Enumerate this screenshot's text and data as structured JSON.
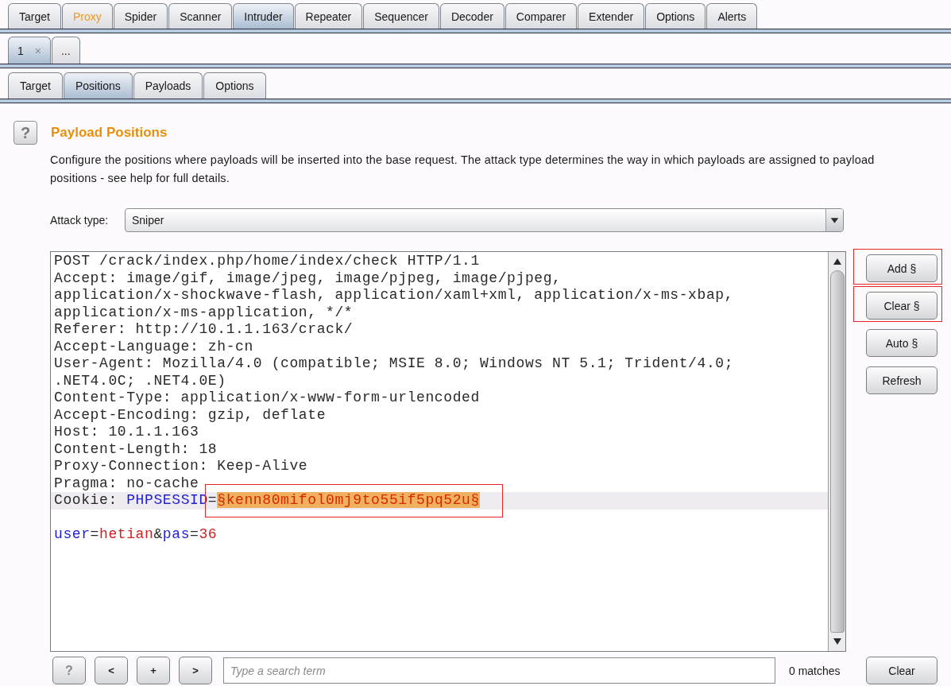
{
  "main_tabs": [
    {
      "label": "Target",
      "selected": false,
      "highlighted": false
    },
    {
      "label": "Proxy",
      "selected": false,
      "highlighted": true
    },
    {
      "label": "Spider",
      "selected": false,
      "highlighted": false
    },
    {
      "label": "Scanner",
      "selected": false,
      "highlighted": false
    },
    {
      "label": "Intruder",
      "selected": true,
      "highlighted": false
    },
    {
      "label": "Repeater",
      "selected": false,
      "highlighted": false
    },
    {
      "label": "Sequencer",
      "selected": false,
      "highlighted": false
    },
    {
      "label": "Decoder",
      "selected": false,
      "highlighted": false
    },
    {
      "label": "Comparer",
      "selected": false,
      "highlighted": false
    },
    {
      "label": "Extender",
      "selected": false,
      "highlighted": false
    },
    {
      "label": "Options",
      "selected": false,
      "highlighted": false
    },
    {
      "label": "Alerts",
      "selected": false,
      "highlighted": false
    }
  ],
  "attack_tabs": [
    {
      "label": "1",
      "close": "×",
      "selected": true
    },
    {
      "label": "...",
      "selected": false
    }
  ],
  "sub_tabs": [
    {
      "label": "Target",
      "selected": false
    },
    {
      "label": "Positions",
      "selected": true
    },
    {
      "label": "Payloads",
      "selected": false
    },
    {
      "label": "Options",
      "selected": false
    }
  ],
  "section": {
    "help": "?",
    "title": "Payload Positions",
    "description": "Configure the positions where payloads will be inserted into the base request. The attack type determines the way in which payloads are assigned to payload positions - see help for full details.",
    "attack_type_label": "Attack type:",
    "attack_type": "Sniper"
  },
  "request": {
    "lines": [
      {
        "kind": "text",
        "current": false,
        "segments": [
          {
            "kind": "plain",
            "text": "POST /crack/index.php/home/index/check HTTP/1.1"
          }
        ]
      },
      {
        "kind": "text",
        "current": false,
        "segments": [
          {
            "kind": "plain",
            "text": "Accept: image/gif, image/jpeg, image/pjpeg, image/pjpeg,"
          }
        ]
      },
      {
        "kind": "text",
        "current": false,
        "segments": [
          {
            "kind": "plain",
            "text": "application/x-shockwave-flash, application/xaml+xml, application/x-ms-xbap,"
          }
        ]
      },
      {
        "kind": "text",
        "current": false,
        "segments": [
          {
            "kind": "plain",
            "text": "application/x-ms-application, */*"
          }
        ]
      },
      {
        "kind": "text",
        "current": false,
        "segments": [
          {
            "kind": "plain",
            "text": "Referer: http://10.1.1.163/crack/"
          }
        ]
      },
      {
        "kind": "text",
        "current": false,
        "segments": [
          {
            "kind": "plain",
            "text": "Accept-Language: zh-cn"
          }
        ]
      },
      {
        "kind": "text",
        "current": false,
        "segments": [
          {
            "kind": "plain",
            "text": "User-Agent: Mozilla/4.0 (compatible; MSIE 8.0; Windows NT 5.1; Trident/4.0;"
          }
        ]
      },
      {
        "kind": "text",
        "current": false,
        "segments": [
          {
            "kind": "plain",
            "text": ".NET4.0C; .NET4.0E)"
          }
        ]
      },
      {
        "kind": "text",
        "current": false,
        "segments": [
          {
            "kind": "plain",
            "text": "Content-Type: application/x-www-form-urlencoded"
          }
        ]
      },
      {
        "kind": "text",
        "current": false,
        "segments": [
          {
            "kind": "plain",
            "text": "Accept-Encoding: gzip, deflate"
          }
        ]
      },
      {
        "kind": "text",
        "current": false,
        "segments": [
          {
            "kind": "plain",
            "text": "Host: 10.1.1.163"
          }
        ]
      },
      {
        "kind": "text",
        "current": false,
        "segments": [
          {
            "kind": "plain",
            "text": "Content-Length: 18"
          }
        ]
      },
      {
        "kind": "text",
        "current": false,
        "segments": [
          {
            "kind": "plain",
            "text": "Proxy-Connection: Keep-Alive"
          }
        ]
      },
      {
        "kind": "text",
        "current": false,
        "segments": [
          {
            "kind": "plain",
            "text": "Pragma: no-cache"
          }
        ]
      },
      {
        "kind": "text",
        "current": true,
        "segments": [
          {
            "kind": "plain",
            "text": "Cookie: "
          },
          {
            "kind": "name",
            "text": "PHPSESSID"
          },
          {
            "kind": "plain",
            "text": "="
          },
          {
            "kind": "payload",
            "text": "§kenn80mifol0mj9to55if5pq52u§",
            "marked": true
          }
        ]
      },
      {
        "kind": "blank",
        "current": false
      },
      {
        "kind": "text",
        "current": false,
        "segments": [
          {
            "kind": "name",
            "text": "user"
          },
          {
            "kind": "plain",
            "text": "="
          },
          {
            "kind": "value",
            "text": "hetian"
          },
          {
            "kind": "plain",
            "text": "&"
          },
          {
            "kind": "name",
            "text": "pas"
          },
          {
            "kind": "plain",
            "text": "="
          },
          {
            "kind": "value",
            "text": "36"
          }
        ]
      }
    ]
  },
  "position_buttons": [
    {
      "label": "Add §",
      "marked": true
    },
    {
      "label": "Clear §",
      "marked": true
    },
    {
      "label": "Auto §",
      "marked": false
    },
    {
      "label": "Refresh",
      "marked": false
    }
  ],
  "search_bar": {
    "help": "?",
    "nav": [
      "<",
      "+",
      ">"
    ],
    "placeholder": "Type a search term",
    "matches": "0 matches",
    "clear": "Clear"
  }
}
